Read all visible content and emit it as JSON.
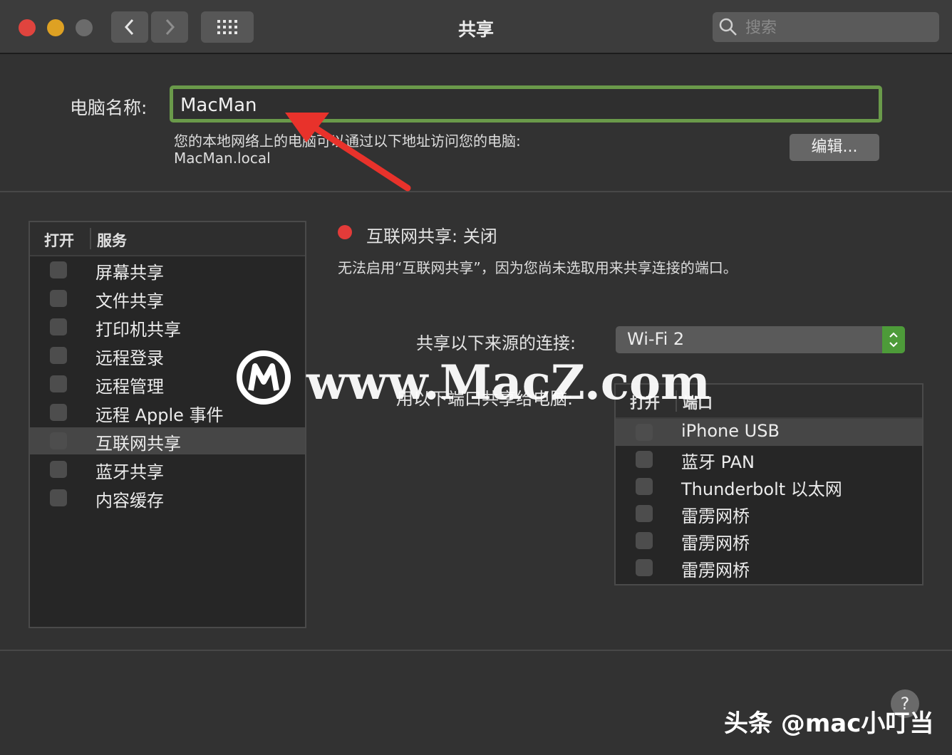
{
  "window": {
    "title": "共享",
    "search_placeholder": "搜索",
    "back_icon": "chevron-left-icon",
    "forward_icon": "chevron-right-icon",
    "grid_icon": "grid-icon",
    "traffic_lights": {
      "close": "#e0443e",
      "minimize": "#dea123",
      "zoom": "#6b6b6b"
    }
  },
  "computer_name": {
    "label": "电脑名称:",
    "value": "MacMan",
    "info_line1": "您的本地网络上的电脑可以通过以下地址访问您的电脑:",
    "info_line2": "MacMan.local",
    "edit_button": "编辑..."
  },
  "services": {
    "col_on": "打开",
    "col_service": "服务",
    "items": [
      {
        "label": "屏幕共享",
        "checked": false,
        "selected": false
      },
      {
        "label": "文件共享",
        "checked": false,
        "selected": false
      },
      {
        "label": "打印机共享",
        "checked": false,
        "selected": false
      },
      {
        "label": "远程登录",
        "checked": false,
        "selected": false
      },
      {
        "label": "远程管理",
        "checked": false,
        "selected": false
      },
      {
        "label": "远程 Apple 事件",
        "checked": false,
        "selected": false
      },
      {
        "label": "互联网共享",
        "checked": false,
        "selected": true
      },
      {
        "label": "蓝牙共享",
        "checked": false,
        "selected": false
      },
      {
        "label": "内容缓存",
        "checked": false,
        "selected": false
      }
    ]
  },
  "detail": {
    "status_text": "互联网共享: 关闭",
    "status_color": "#e33b39",
    "message": "无法启用“互联网共享”，因为您尚未选取用来共享连接的端口。",
    "share_from_label": "共享以下来源的连接:",
    "share_from_value": "Wi-Fi 2",
    "to_computers_label": "用以下端口共享给电脑:",
    "ports": {
      "col_on": "打开",
      "col_port": "端口",
      "items": [
        {
          "label": "iPhone USB",
          "checked": false,
          "selected": true
        },
        {
          "label": "蓝牙 PAN",
          "checked": false,
          "selected": false
        },
        {
          "label": "Thunderbolt 以太网",
          "checked": false,
          "selected": false
        },
        {
          "label": "雷雳网桥",
          "checked": false,
          "selected": false
        },
        {
          "label": "雷雳网桥",
          "checked": false,
          "selected": false
        },
        {
          "label": "雷雳网桥",
          "checked": false,
          "selected": false
        }
      ]
    }
  },
  "overlay": {
    "watermark": "www.MacZ.com",
    "credit": "头条 @mac小叮当",
    "help_label": "?"
  }
}
